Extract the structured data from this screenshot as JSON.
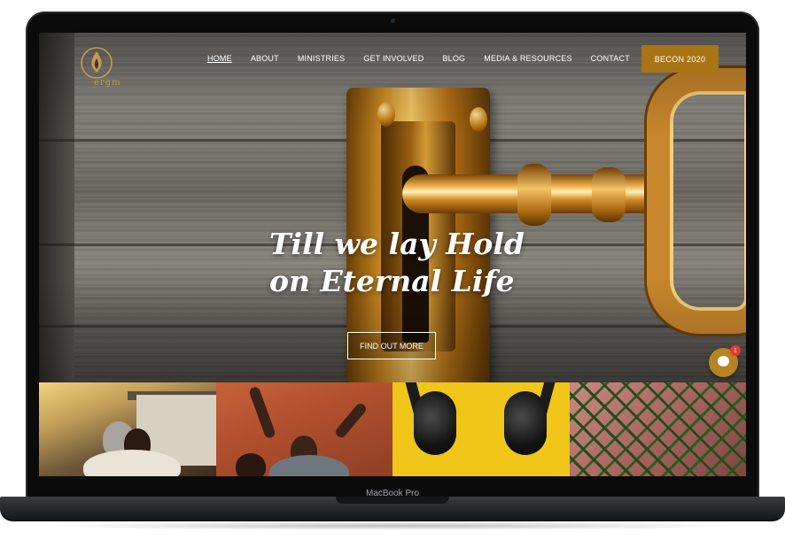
{
  "device": {
    "model_label": "MacBook Pro"
  },
  "site": {
    "logo_text": "ergm",
    "nav": [
      {
        "label": "HOME",
        "active": true
      },
      {
        "label": "ABOUT"
      },
      {
        "label": "MINISTRIES"
      },
      {
        "label": "GET INVOLVED"
      },
      {
        "label": "BLOG"
      },
      {
        "label": "MEDIA & RESOURCES"
      },
      {
        "label": "CONTACT"
      }
    ],
    "cta_label": "BECON 2020",
    "hero": {
      "headline_line1": "Till we lay Hold",
      "headline_line2": "on Eternal Life",
      "button_label": "FIND OUT MORE"
    },
    "chat": {
      "badge_count": "1"
    }
  },
  "colors": {
    "accent": "#a97416",
    "chat": "#b78424",
    "badge": "#e53935"
  },
  "icons": [
    "logo-mark-icon",
    "chat-icon"
  ],
  "tiles": [
    {
      "name": "tile-embrace"
    },
    {
      "name": "tile-celebration"
    },
    {
      "name": "tile-headphones"
    },
    {
      "name": "tile-network"
    }
  ]
}
